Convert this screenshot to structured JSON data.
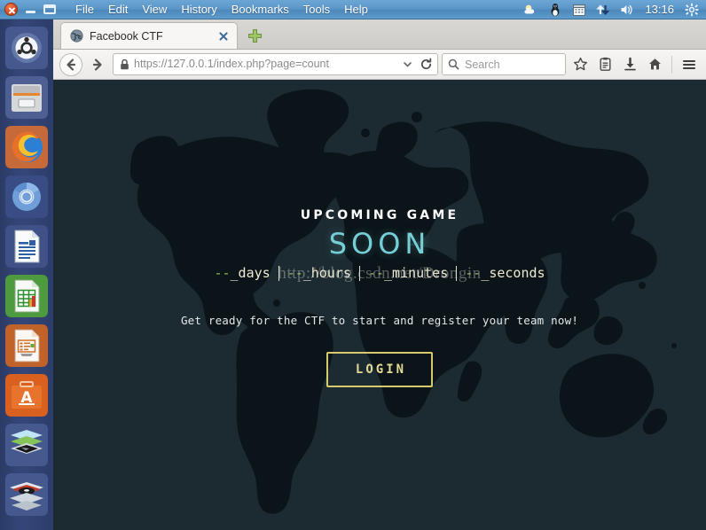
{
  "window": {
    "controls": {
      "close": "close",
      "minimize": "minimize",
      "maximize": "maximize"
    },
    "menus": [
      "File",
      "Edit",
      "View",
      "History",
      "Bookmarks",
      "Tools",
      "Help"
    ]
  },
  "tray": {
    "icons": [
      "weather-icon",
      "linux-penguin-icon",
      "calendar-icon",
      "network-transfer-icon",
      "volume-icon"
    ],
    "time": "13:16",
    "settings_icon": "gear-icon"
  },
  "launcher": {
    "items": [
      {
        "name": "ubuntu-dash",
        "icon": "ubuntu-logo-icon",
        "active": false
      },
      {
        "name": "files",
        "icon": "file-manager-icon",
        "active": false
      },
      {
        "name": "firefox",
        "icon": "firefox-icon",
        "active": true
      },
      {
        "name": "chromium",
        "icon": "chromium-icon",
        "active": false
      },
      {
        "name": "libreoffice-writer",
        "icon": "document-icon",
        "active": false
      },
      {
        "name": "libreoffice-calc",
        "icon": "spreadsheet-icon",
        "active": false
      },
      {
        "name": "libreoffice-impress",
        "icon": "presentation-icon",
        "active": false
      },
      {
        "name": "ubuntu-software",
        "icon": "software-center-icon",
        "active": false
      },
      {
        "name": "workspace-switcher",
        "icon": "workspace-icon",
        "active": false
      },
      {
        "name": "trash",
        "icon": "trash-icon",
        "active": false
      }
    ]
  },
  "browser": {
    "tab": {
      "title": "Facebook CTF",
      "favicon": "globe-icon",
      "close_icon": "close-icon"
    },
    "new_tab_icon": "plus-icon",
    "nav": {
      "back_icon": "back-arrow-icon",
      "forward_icon": "forward-arrow-icon",
      "reload_icon": "reload-icon",
      "dropdown_icon": "chevron-down-icon"
    },
    "url": {
      "lock_icon": "padlock-icon",
      "scheme": "https://",
      "host": "127.0.0.1",
      "path": "/index.php?page=count",
      "full": "https://127.0.0.1/index.php?page=count"
    },
    "search": {
      "icon": "search-icon",
      "placeholder": "Search",
      "value": ""
    },
    "toolbar_icons": [
      "bookmark-star-icon",
      "reading-list-icon",
      "downloads-icon",
      "home-icon",
      "hamburger-menu-icon"
    ]
  },
  "page": {
    "background_color": "#1c2b31",
    "map_color": "#0b1418",
    "heading": "UPCOMING GAME",
    "status": "SOON",
    "status_color": "#76cfd6",
    "watermark": "http://blog.csdn.net/Drongin",
    "countdown": [
      {
        "value": "--",
        "unit": "_days"
      },
      {
        "value": "--",
        "unit": "_hours"
      },
      {
        "value": "--",
        "unit": "_minutes"
      },
      {
        "value": "--",
        "unit": "_seconds"
      }
    ],
    "countdown_value_color": "#9bbb59",
    "countdown_unit_color": "#efead0",
    "tagline": "Get ready for the CTF to start and register your team now!",
    "login_label": "LOGIN",
    "login_border_color": "#d6c96e"
  }
}
